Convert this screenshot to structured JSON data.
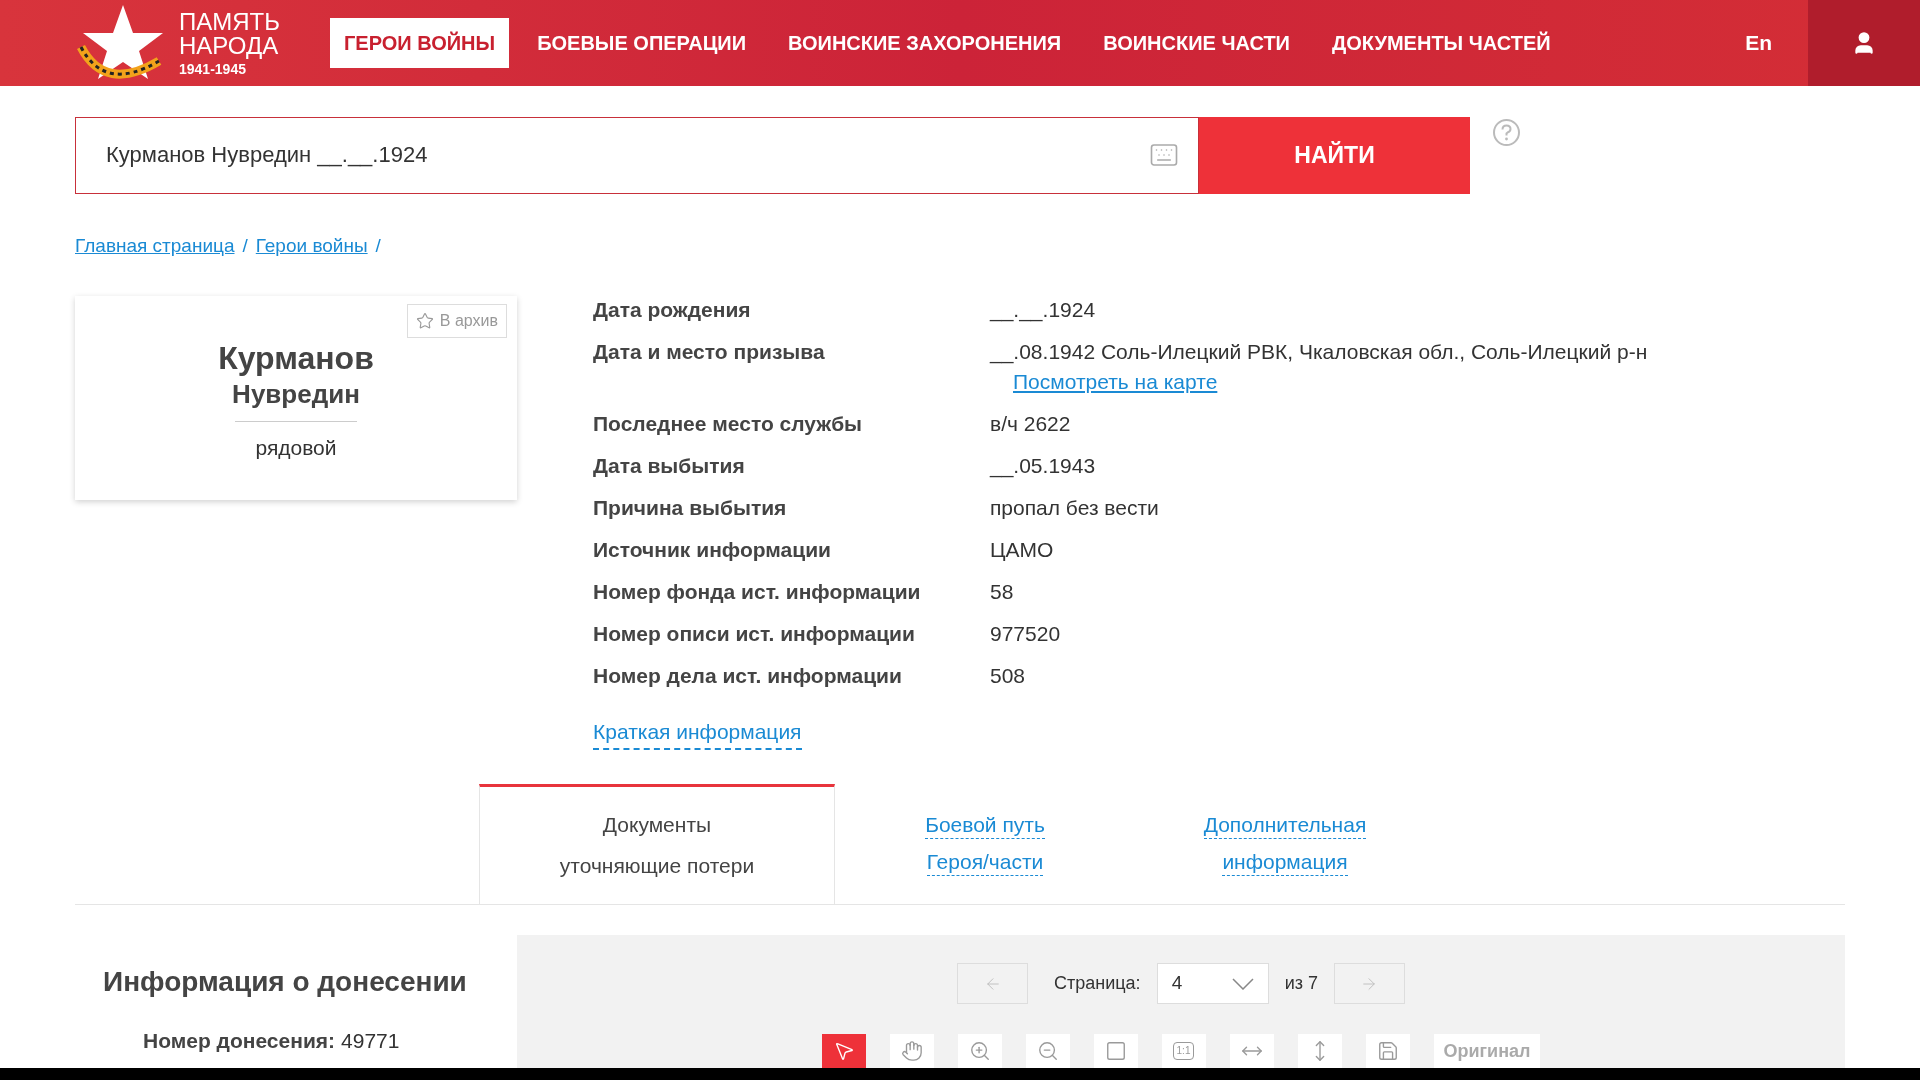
{
  "header": {
    "logo": {
      "line1": "ПАМЯТЬ",
      "line2": "НАРОДА",
      "years": "1941-1945"
    },
    "nav": [
      {
        "label": "ГЕРОИ ВОЙНЫ",
        "selected": true
      },
      {
        "label": "БОЕВЫЕ ОПЕРАЦИИ",
        "selected": false
      },
      {
        "label": "ВОИНСКИЕ ЗАХОРОНЕНИЯ",
        "selected": false
      },
      {
        "label": "ВОИНСКИЕ ЧАСТИ",
        "selected": false
      },
      {
        "label": "ДОКУМЕНТЫ ЧАСТЕЙ",
        "selected": false
      }
    ],
    "language": "En"
  },
  "search": {
    "value": "Курманов Нувредин __.__.1924",
    "button": "НАЙТИ"
  },
  "breadcrumbs": [
    {
      "kind": "link",
      "label": "Главная страница"
    },
    {
      "kind": "separator",
      "label": "/"
    },
    {
      "kind": "link",
      "label": "Герои войны"
    },
    {
      "kind": "separator",
      "label": "/"
    }
  ],
  "person": {
    "archive_button": "В архив",
    "surname": "Курманов",
    "name": "Нувредин",
    "rank": "рядовой"
  },
  "details": [
    {
      "label": "Дата рождения",
      "value": "__.__.1924"
    },
    {
      "label": "Дата и место призыва",
      "value": "__.08.1942 Соль-Илецкий РВК, Чкаловская обл., Соль-Илецкий р-н",
      "link": "Посмотреть на карте"
    },
    {
      "label": "Последнее место службы",
      "value": "в/ч 2622"
    },
    {
      "label": "Дата выбытия",
      "value": "__.05.1943"
    },
    {
      "label": "Причина выбытия",
      "value": "пропал без вести"
    },
    {
      "label": "Источник информации",
      "value": "ЦАМО"
    },
    {
      "label": "Номер фонда ист. информации",
      "value": "58"
    },
    {
      "label": "Номер описи ист. информации",
      "value": "977520"
    },
    {
      "label": "Номер дела ист. информации",
      "value": "508"
    }
  ],
  "summary_link": "Краткая информация",
  "tabs": [
    {
      "lines": [
        "Документы",
        "уточняющие потери"
      ],
      "selected": true
    },
    {
      "lines": [
        "Боевой путь",
        "Героя/части"
      ],
      "selected": false
    },
    {
      "lines": [
        "Дополнительная",
        "информация"
      ],
      "selected": false
    }
  ],
  "report": {
    "title": "Информация о донесении",
    "fields": [
      {
        "label": "Номер донесения:",
        "value": "49771"
      }
    ]
  },
  "viewer": {
    "page_label": "Страница:",
    "page": "4",
    "page_total": "из 7",
    "tools": [
      {
        "kind": "pointer",
        "selected": true
      },
      {
        "kind": "hand",
        "selected": false
      },
      {
        "kind": "zoom-in",
        "selected": false
      },
      {
        "kind": "zoom-out",
        "selected": false
      },
      {
        "kind": "frame",
        "selected": false
      },
      {
        "kind": "actual-size",
        "label": "1:1",
        "selected": false
      },
      {
        "kind": "fit-width",
        "selected": false
      },
      {
        "kind": "fit-height",
        "selected": false
      },
      {
        "kind": "save",
        "selected": false
      },
      {
        "kind": "text",
        "label": "Оригинал",
        "selected": false
      }
    ]
  }
}
